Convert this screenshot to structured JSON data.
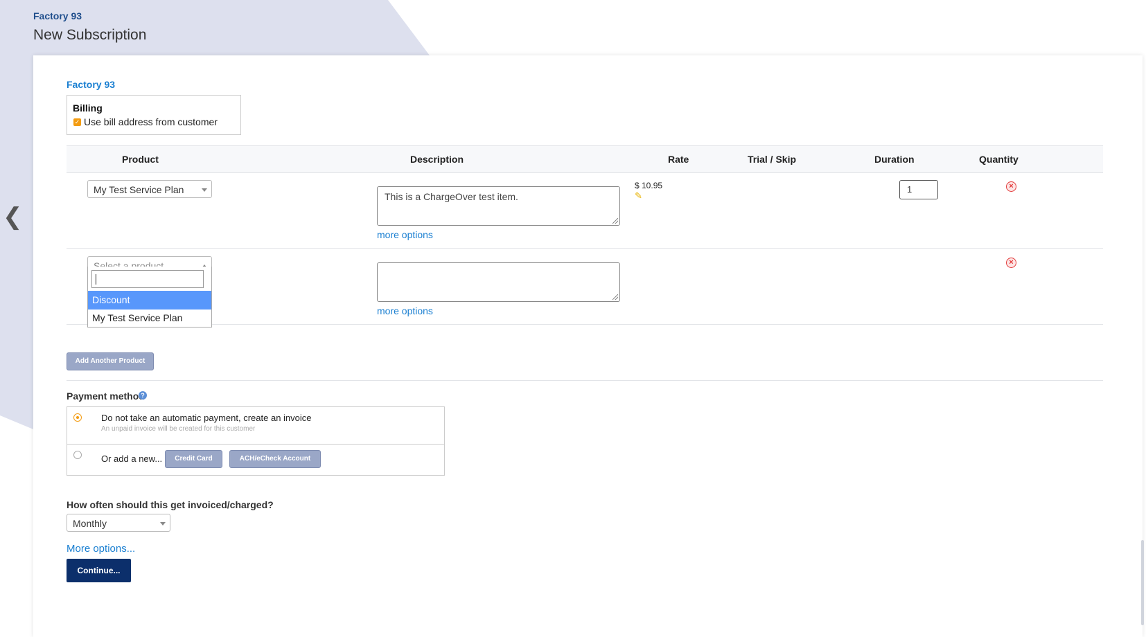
{
  "header": {
    "breadcrumb": "Factory 93",
    "title": "New Subscription"
  },
  "customer": {
    "name": "Factory 93"
  },
  "billing": {
    "title": "Billing",
    "use_bill_address_label": "Use bill address from customer",
    "use_bill_address_checked": true
  },
  "table": {
    "columns": [
      "Product",
      "Description",
      "Rate",
      "Trial / Skip",
      "Duration",
      "Quantity"
    ]
  },
  "line_items": [
    {
      "product": "My Test Service Plan",
      "description": "This is a ChargeOver test item.",
      "more_options": "more options",
      "rate": "$ 10.95",
      "quantity": "1"
    },
    {
      "product_placeholder": "Select a product",
      "description": "",
      "more_options": "more options"
    }
  ],
  "product_dropdown": {
    "search_value": "",
    "options": [
      "Discount",
      "My Test Service Plan"
    ],
    "highlighted": "Discount"
  },
  "add_product_label": "Add Another Product",
  "payment": {
    "label": "Payment method",
    "option_invoice": "Do not take an automatic payment, create an invoice",
    "option_invoice_note": "An unpaid invoice will be created for this customer",
    "option_add_new": "Or add a new...",
    "credit_card_label": "Credit Card",
    "ach_label": "ACH/eCheck Account",
    "selected": "invoice"
  },
  "frequency": {
    "label": "How often should this get invoiced/charged?",
    "value": "Monthly"
  },
  "more_options_label": "More options...",
  "continue_label": "Continue...",
  "colors": {
    "accent": "#1a7fd1",
    "primary_button": "#0c2f6b",
    "secondary_button": "#9aa7c7",
    "checkbox": "#f39c12",
    "highlight": "#5897fb"
  }
}
